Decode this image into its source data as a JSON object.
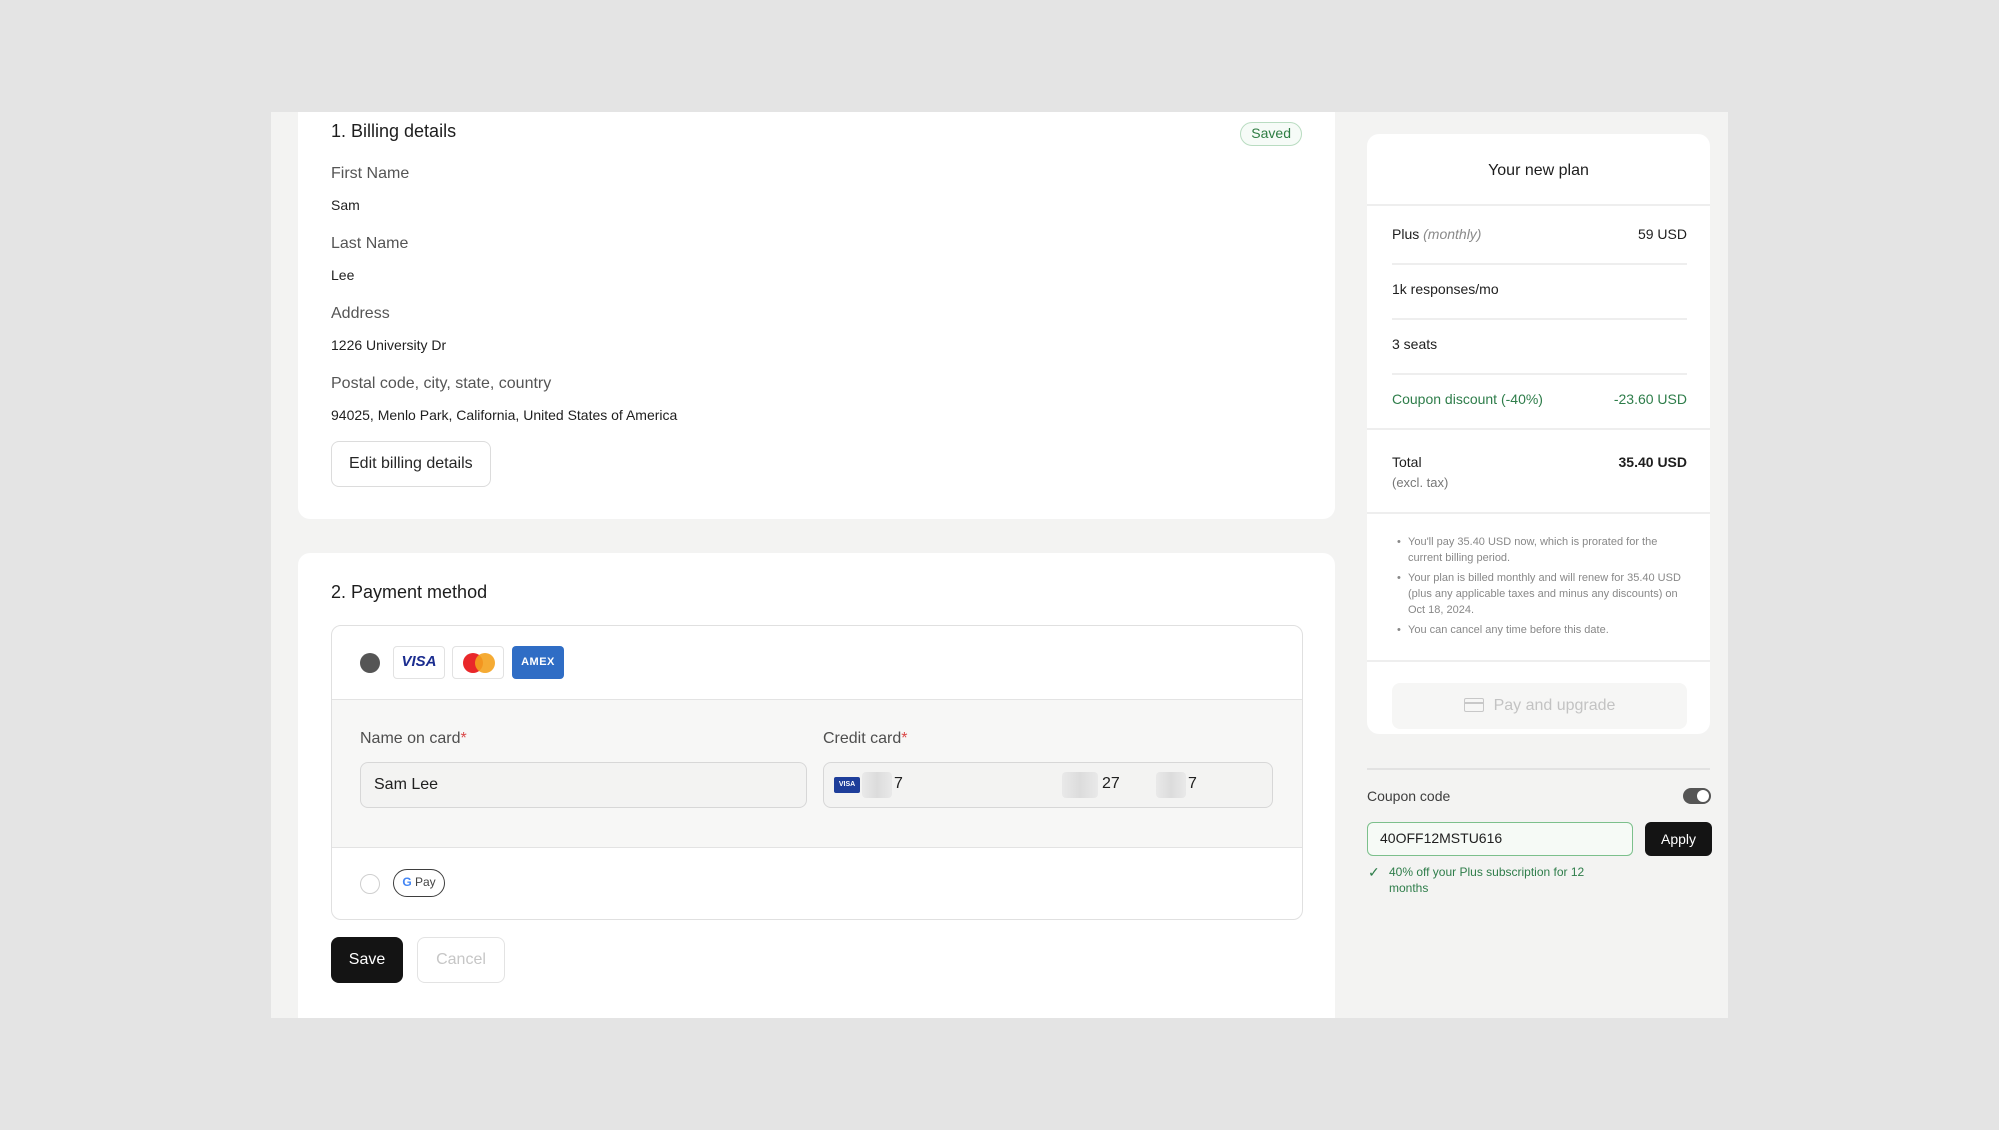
{
  "billing": {
    "title": "1. Billing details",
    "badge": "Saved",
    "first_name_label": "First Name",
    "first_name": "Sam",
    "last_name_label": "Last Name",
    "last_name": "Lee",
    "address_label": "Address",
    "address": "1226 University Dr",
    "postal_label": "Postal code, city, state, country",
    "postal": "94025, Menlo Park, California, United States of America",
    "edit_button": "Edit billing details"
  },
  "payment": {
    "title": "2. Payment method",
    "card_brands": [
      "VISA",
      "mastercard-icon",
      "AMEX"
    ],
    "visa_label": "VISA",
    "amex_label": "AMEX",
    "name_label": "Name on card",
    "name_value": "Sam Lee",
    "card_label": "Credit card",
    "required_mark": "*",
    "card_mini_label": "VISA",
    "card_segments": [
      "7",
      "27",
      "7"
    ],
    "gpay_label_g": "G",
    "gpay_label_pay": "Pay",
    "save_button": "Save",
    "cancel_button": "Cancel"
  },
  "plan": {
    "title": "Your new plan",
    "plan_name": "Plus",
    "plan_period": "(monthly)",
    "plan_price": "59 USD",
    "feature_1": "1k responses/mo",
    "feature_2": "3 seats",
    "coupon_label": "Coupon discount (-40%)",
    "coupon_amount": "-23.60 USD",
    "total_label": "Total",
    "total_note": "(excl. tax)",
    "total_amount": "35.40 USD",
    "notes": [
      "You'll pay 35.40 USD now, which is prorated for the current billing period.",
      "Your plan is billed monthly and will renew for 35.40 USD (plus any applicable taxes and minus any discounts) on Oct 18, 2024.",
      "You can cancel any time before this date."
    ],
    "pay_button": "Pay and upgrade"
  },
  "coupon": {
    "label": "Coupon code",
    "toggle_on": true,
    "value": "40OFF12MSTU616",
    "apply_button": "Apply",
    "success": "40% off your Plus subscription for 12 months"
  },
  "colors": {
    "accent_green": "#2e7d4a",
    "primary_button": "#141414",
    "page_bg": "#e4e4e4"
  }
}
